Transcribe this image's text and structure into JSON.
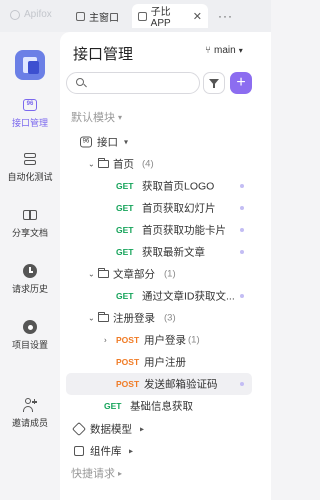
{
  "app": {
    "name": "Apifox"
  },
  "tabs": [
    {
      "label": "主窗口"
    },
    {
      "label": "子比APP",
      "close": "✕"
    }
  ],
  "tab_more": "···",
  "rail": [
    {
      "label": "接口管理",
      "icon": "api-badge-icon",
      "active": true
    },
    {
      "label": "自动化测试",
      "icon": "layers-icon"
    },
    {
      "label": "分享文档",
      "icon": "book-icon"
    },
    {
      "label": "请求历史",
      "icon": "clock-icon"
    },
    {
      "label": "项目设置",
      "icon": "gear-icon"
    },
    {
      "label": "邀请成员",
      "icon": "add-user-icon"
    }
  ],
  "panel": {
    "title": "接口管理",
    "branch": "main",
    "search": {
      "placeholder": ""
    },
    "add_label": "+",
    "default_module": "默认模块",
    "root": "接口",
    "tree": [
      {
        "type": "folder",
        "name": "首页",
        "count": "(4)"
      },
      {
        "type": "api",
        "method": "GET",
        "name": "获取首页LOGO"
      },
      {
        "type": "api",
        "method": "GET",
        "name": "首页获取幻灯片"
      },
      {
        "type": "api",
        "method": "GET",
        "name": "首页获取功能卡片"
      },
      {
        "type": "api",
        "method": "GET",
        "name": "获取最新文章"
      },
      {
        "type": "folder",
        "name": "文章部分",
        "count": "(1)"
      },
      {
        "type": "api",
        "method": "GET",
        "name": "通过文章ID获取文..."
      },
      {
        "type": "folder",
        "name": "注册登录",
        "count": "(3)"
      },
      {
        "type": "folder",
        "method": "POST",
        "name": "用户登录",
        "count": "(1)"
      },
      {
        "type": "api",
        "method": "POST",
        "name": "用户注册"
      },
      {
        "type": "api",
        "method": "POST",
        "name": "发送邮箱验证码"
      },
      {
        "type": "api",
        "method": "GET",
        "name": "基础信息获取"
      }
    ],
    "data_model": "数据模型",
    "components": "组件库",
    "quick_request": "快捷请求"
  },
  "colors": {
    "accent": "#8c6df0",
    "get": "#15a35a",
    "post": "#f07b25"
  }
}
